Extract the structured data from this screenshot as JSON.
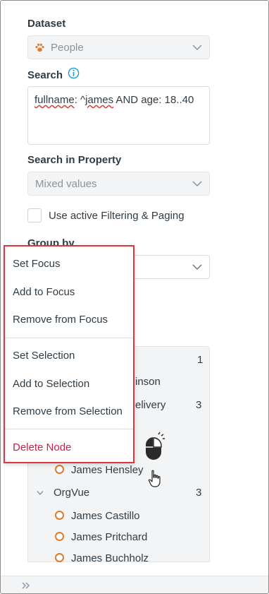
{
  "dataset": {
    "label": "Dataset",
    "value": "People",
    "icon": "paw-icon"
  },
  "search": {
    "label": "Search",
    "query_prefix": "fullname",
    "query_mid": ": ^",
    "query_word": "james",
    "query_rest": " AND age: 18..40"
  },
  "search_in_property": {
    "label": "Search in Property",
    "value": "Mixed values"
  },
  "filter": {
    "label": "Use active Filtering & Paging",
    "checked": false
  },
  "group_by": {
    "label": "Group by"
  },
  "tree": {
    "rows": [
      {
        "count": "1"
      },
      {
        "text": "inson"
      },
      {
        "text": "elivery",
        "count": "3"
      },
      {
        "text": "James Hensley",
        "node": true
      },
      {
        "text": "OrgVue",
        "count": "3",
        "group": true
      },
      {
        "text": "James Castillo",
        "node": true
      },
      {
        "text": "James Pritchard",
        "node": true
      },
      {
        "text": "James Buchholz",
        "node": true
      }
    ]
  },
  "context_menu": {
    "items": [
      "Set Focus",
      "Add to Focus",
      "Remove from Focus",
      "Set Selection",
      "Add to Selection",
      "Remove from Selection",
      "Delete Node"
    ]
  },
  "colors": {
    "node": "#e07b2a",
    "menu_border": "#e0353f",
    "danger": "#c8204a",
    "info": "#1a9ad6"
  }
}
